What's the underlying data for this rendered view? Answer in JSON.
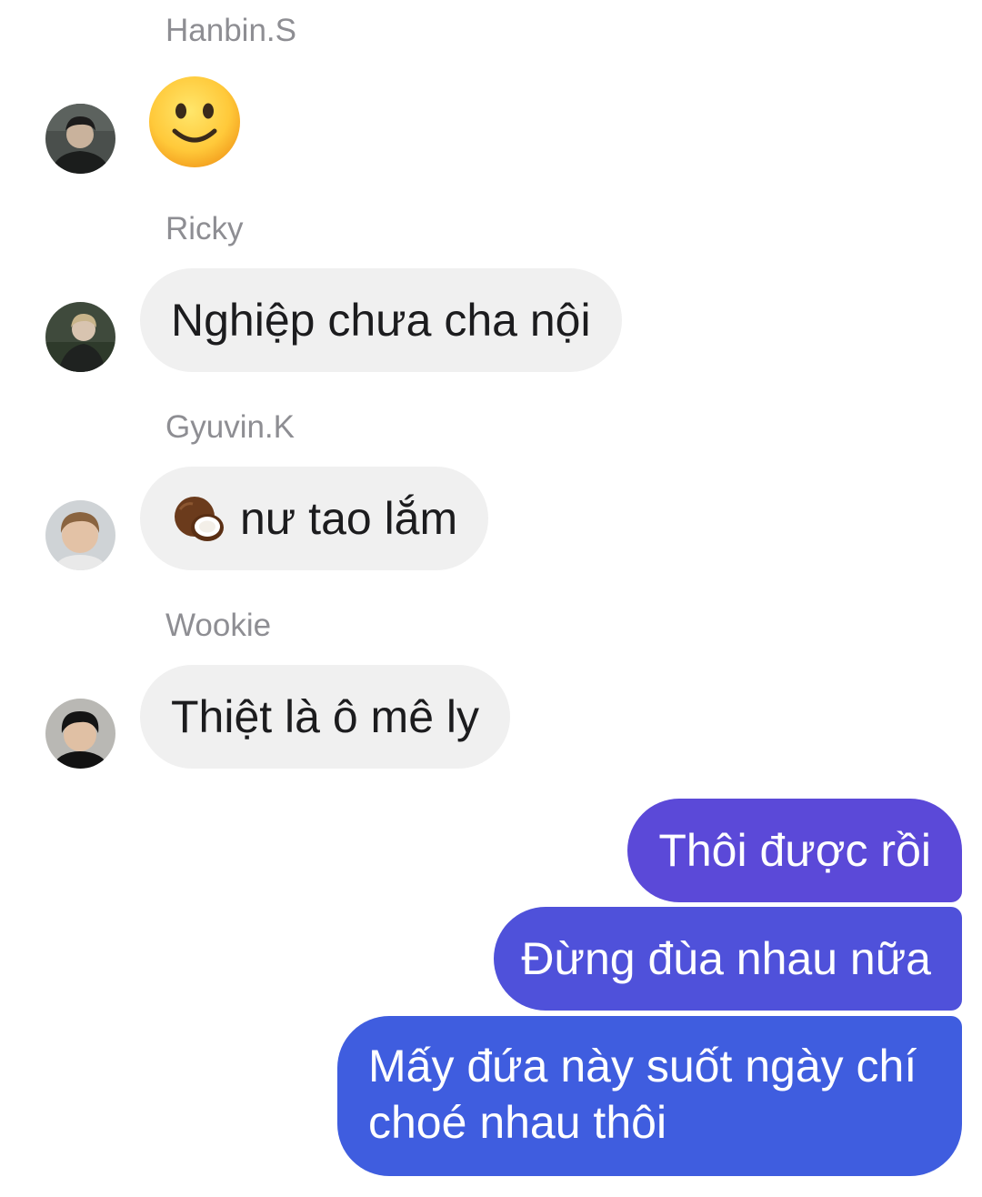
{
  "messages": {
    "m1": {
      "sender": "Hanbin.S",
      "emoji": "slightly-smiling-face"
    },
    "m2": {
      "sender": "Ricky",
      "text": "Nghiệp chưa cha nội"
    },
    "m3": {
      "sender": "Gyuvin.K",
      "emoji": "coconut",
      "text": "nư tao lắm"
    },
    "m4": {
      "sender": "Wookie",
      "text": "Thiệt là ô mê ly"
    }
  },
  "outgoing": {
    "o1": "Thôi được rồi",
    "o2": "Đừng đùa nhau nữa",
    "o3": "Mấy đứa này suốt ngày chí choé nhau thôi"
  },
  "colors": {
    "incoming_bubble": "#f0f0f0",
    "outgoing_top": "#5b49d8",
    "outgoing_mid": "#4f51da",
    "outgoing_bottom": "#3f5ddf",
    "sender_name": "#8e8e93"
  }
}
